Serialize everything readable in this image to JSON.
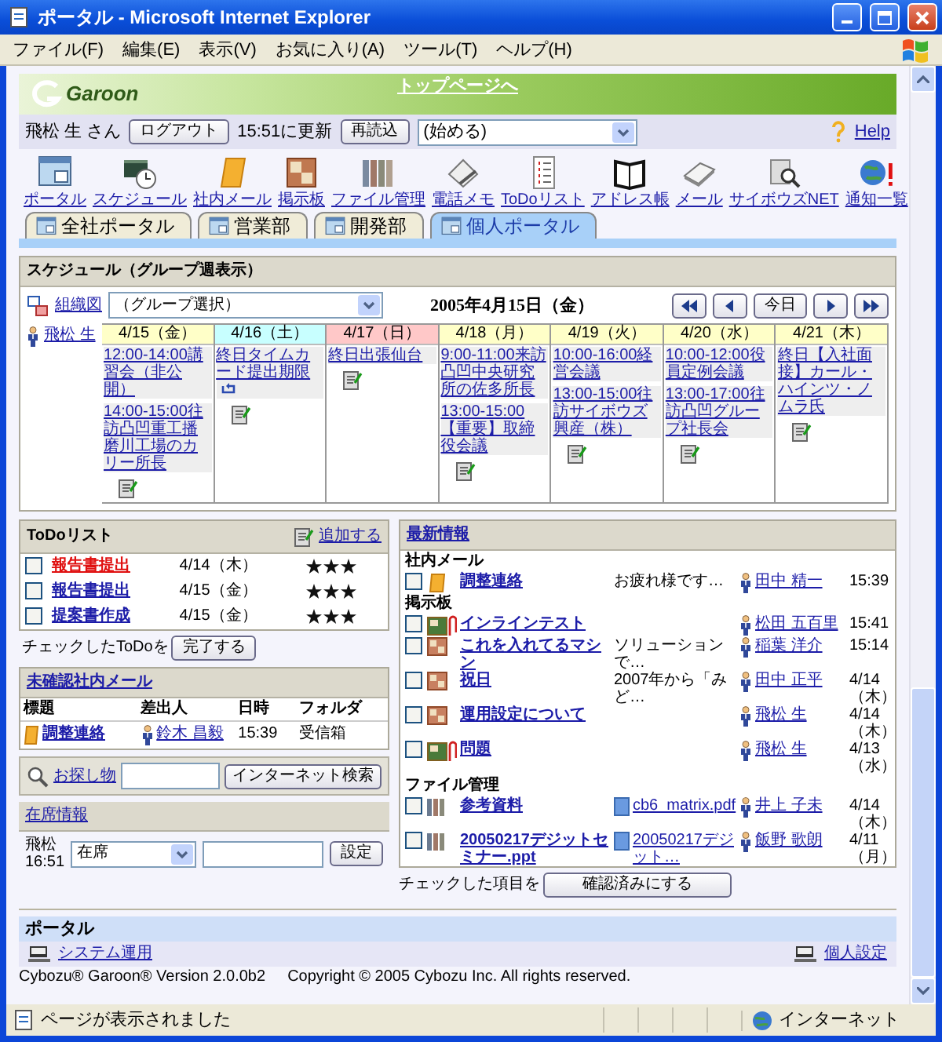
{
  "window": {
    "title": "ポータル - Microsoft Internet Explorer"
  },
  "menu_bar": [
    "ファイル(F)",
    "編集(E)",
    "表示(V)",
    "お気に入り(A)",
    "ツール(T)",
    "ヘルプ(H)"
  ],
  "banner": {
    "logo": "Garoon",
    "top_link": "トップページへ"
  },
  "user_bar": {
    "user": "飛松 生 さん",
    "logout_button": "ログアウト",
    "updated": "15:51に更新",
    "reload_button": "再読込",
    "start_select": "(始める)",
    "help_link": "Help"
  },
  "apps": [
    {
      "label": "ポータル",
      "kind": "portal"
    },
    {
      "label": "スケジュール",
      "kind": "schedule"
    },
    {
      "label": "社内メール",
      "kind": "message"
    },
    {
      "label": "掲示板",
      "kind": "board"
    },
    {
      "label": "ファイル管理",
      "kind": "file"
    },
    {
      "label": "電話メモ",
      "kind": "phone_memo"
    },
    {
      "label": "ToDoリスト",
      "kind": "todo"
    },
    {
      "label": "アドレス帳",
      "kind": "address"
    },
    {
      "label": "メール",
      "kind": "mail"
    },
    {
      "label": "サイボウズNET",
      "kind": "net"
    },
    {
      "label": "通知一覧",
      "kind": "notification"
    }
  ],
  "tabs": [
    {
      "label": "全社ポータル",
      "selected": false
    },
    {
      "label": "営業部",
      "selected": false
    },
    {
      "label": "開発部",
      "selected": false
    },
    {
      "label": "個人ポータル",
      "selected": true
    }
  ],
  "schedule": {
    "title": "スケジュール（グループ週表示）",
    "org_link": "組織図",
    "group_select": "（グループ選択）",
    "date": "2005年4月15日（金）",
    "today_button": "今日",
    "user": "飛松 生",
    "days": [
      {
        "label": "4/15（金）",
        "color": "#ffffc8",
        "events": [
          {
            "text": "12:00-14:00講習会（非公開）",
            "repeating": false
          },
          {
            "text": "14:00-15:00往訪凸凹重工播磨川工場のカリー所長",
            "repeating": false
          }
        ]
      },
      {
        "label": "4/16（土）",
        "color": "#c8ffff",
        "events": [
          {
            "text": "終日タイムカード提出期限",
            "repeating": true
          }
        ]
      },
      {
        "label": "4/17（日）",
        "color": "#ffc8c8",
        "events": [
          {
            "text": "終日出張仙台",
            "repeating": false
          }
        ]
      },
      {
        "label": "4/18（月）",
        "color": "#ffffc8",
        "events": [
          {
            "text": "9:00-11:00来訪凸凹中央研究所の佐多所長",
            "repeating": false
          },
          {
            "text": "13:00-15:00【重要】取締役会議",
            "repeating": false
          }
        ]
      },
      {
        "label": "4/19（火）",
        "color": "#ffffc8",
        "events": [
          {
            "text": "10:00-16:00経営会議",
            "repeating": false
          },
          {
            "text": "13:00-15:00往訪サイボウズ興産（株）",
            "repeating": false
          }
        ]
      },
      {
        "label": "4/20（水）",
        "color": "#ffffc8",
        "events": [
          {
            "text": "10:00-12:00役員定例会議",
            "repeating": false
          },
          {
            "text": "13:00-17:00往訪凸凹グループ社長会",
            "repeating": false
          }
        ]
      },
      {
        "label": "4/21（木）",
        "color": "#ffffc8",
        "events": [
          {
            "text": "終日【入社面接】カール・ハインツ・ノムラ氏",
            "repeating": false
          }
        ]
      }
    ]
  },
  "todo": {
    "title": "ToDoリスト",
    "add_link": "追加する",
    "items": [
      {
        "title": "報告書提出",
        "due": "4/14（木）",
        "stars": 3,
        "checked": false,
        "overdue": true
      },
      {
        "title": "報告書提出",
        "due": "4/15（金）",
        "stars": 3,
        "checked": false,
        "overdue": false
      },
      {
        "title": "提案書作成",
        "due": "4/15（金）",
        "stars": 3,
        "checked": false,
        "overdue": false
      }
    ],
    "footer_text": "チェックしたToDoを",
    "complete_button": "完了する"
  },
  "unread_mail": {
    "title": "未確認社内メール",
    "columns": [
      "標題",
      "差出人",
      "日時",
      "フォルダ"
    ],
    "rows": [
      {
        "subject": "調整連絡",
        "sender": "鈴木 昌毅",
        "time": "15:39",
        "folder": "受信箱"
      }
    ]
  },
  "search": {
    "link": "お探し物",
    "button": "インターネット検索"
  },
  "presence": {
    "title": "在席情報",
    "user": "飛松",
    "time": "16:51",
    "status_select": "在席",
    "button": "設定"
  },
  "news": {
    "title": "最新情報",
    "sections": [
      {
        "heading": "社内メール",
        "rows": [
          {
            "kind": "mail",
            "title": "調整連絡",
            "excerpt": "お疲れ様です…",
            "author": "田中 精一",
            "time": "15:39",
            "checked": false
          }
        ]
      },
      {
        "heading": "掲示板",
        "rows": [
          {
            "kind": "board_attached",
            "title": "インラインテスト",
            "author": "松田 五百里",
            "time": "15:41",
            "checked": false
          },
          {
            "kind": "board",
            "title": "これを入れてるマシン",
            "excerpt": "ソリューションで…",
            "author": "稲葉 洋介",
            "time": "15:14",
            "checked": false
          },
          {
            "kind": "board",
            "title": "祝日",
            "excerpt": "2007年から「みど…",
            "author": "田中 正平",
            "time": "4/14（木）",
            "checked": false
          },
          {
            "kind": "board",
            "title": "運用設定について",
            "author": "飛松 生",
            "time": "4/14（木）",
            "checked": false
          },
          {
            "kind": "board_attached",
            "title": "問題",
            "author": "飛松 生",
            "time": "4/13（水）",
            "checked": false
          }
        ]
      },
      {
        "heading": "ファイル管理",
        "rows": [
          {
            "kind": "file",
            "title": "参考資料",
            "file": "cb6_matrix.pdf",
            "author": "井上 子未",
            "time": "4/14（木）",
            "checked": false
          },
          {
            "kind": "file",
            "title": "20050217デジットセミナー.ppt",
            "file": "20050217デジット…",
            "author": "飯野 歌朗",
            "time": "4/11（月）",
            "checked": false
          }
        ]
      }
    ],
    "footer_text": "チェックした項目を",
    "confirm_button": "確認済みにする"
  },
  "portal_footer": {
    "title": "ポータル",
    "system_link": "システム運用",
    "personal_link": "個人設定",
    "version": "Cybozu® Garoon® Version 2.0.0b2",
    "copyright": "Copyright © 2005 Cybozu Inc. All rights reserved."
  },
  "status_bar": {
    "text": "ページが表示されました",
    "zone": "インターネット"
  }
}
